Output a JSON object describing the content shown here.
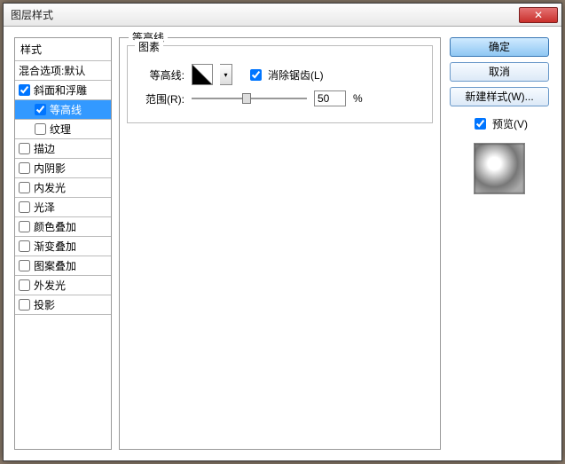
{
  "title": "图层样式",
  "close_glyph": "✕",
  "sidebar": {
    "header": "样式",
    "blend_row": "混合选项:默认",
    "items": [
      {
        "label": "斜面和浮雕",
        "checked": true,
        "selected": false,
        "child": false
      },
      {
        "label": "等高线",
        "checked": true,
        "selected": true,
        "child": true
      },
      {
        "label": "纹理",
        "checked": false,
        "selected": false,
        "child": true
      },
      {
        "label": "描边",
        "checked": false,
        "selected": false,
        "child": false
      },
      {
        "label": "内阴影",
        "checked": false,
        "selected": false,
        "child": false
      },
      {
        "label": "内发光",
        "checked": false,
        "selected": false,
        "child": false
      },
      {
        "label": "光泽",
        "checked": false,
        "selected": false,
        "child": false
      },
      {
        "label": "颜色叠加",
        "checked": false,
        "selected": false,
        "child": false
      },
      {
        "label": "渐变叠加",
        "checked": false,
        "selected": false,
        "child": false
      },
      {
        "label": "图案叠加",
        "checked": false,
        "selected": false,
        "child": false
      },
      {
        "label": "外发光",
        "checked": false,
        "selected": false,
        "child": false
      },
      {
        "label": "投影",
        "checked": false,
        "selected": false,
        "child": false
      }
    ]
  },
  "panel": {
    "title": "等高线",
    "group_title": "图素",
    "contour_label": "等高线:",
    "antialias_label": "消除锯齿(L)",
    "antialias_checked": true,
    "range_label": "范围(R):",
    "range_value": "50",
    "range_unit": "%"
  },
  "buttons": {
    "ok": "确定",
    "cancel": "取消",
    "new_style": "新建样式(W)...",
    "preview_label": "预览(V)",
    "preview_checked": true
  }
}
